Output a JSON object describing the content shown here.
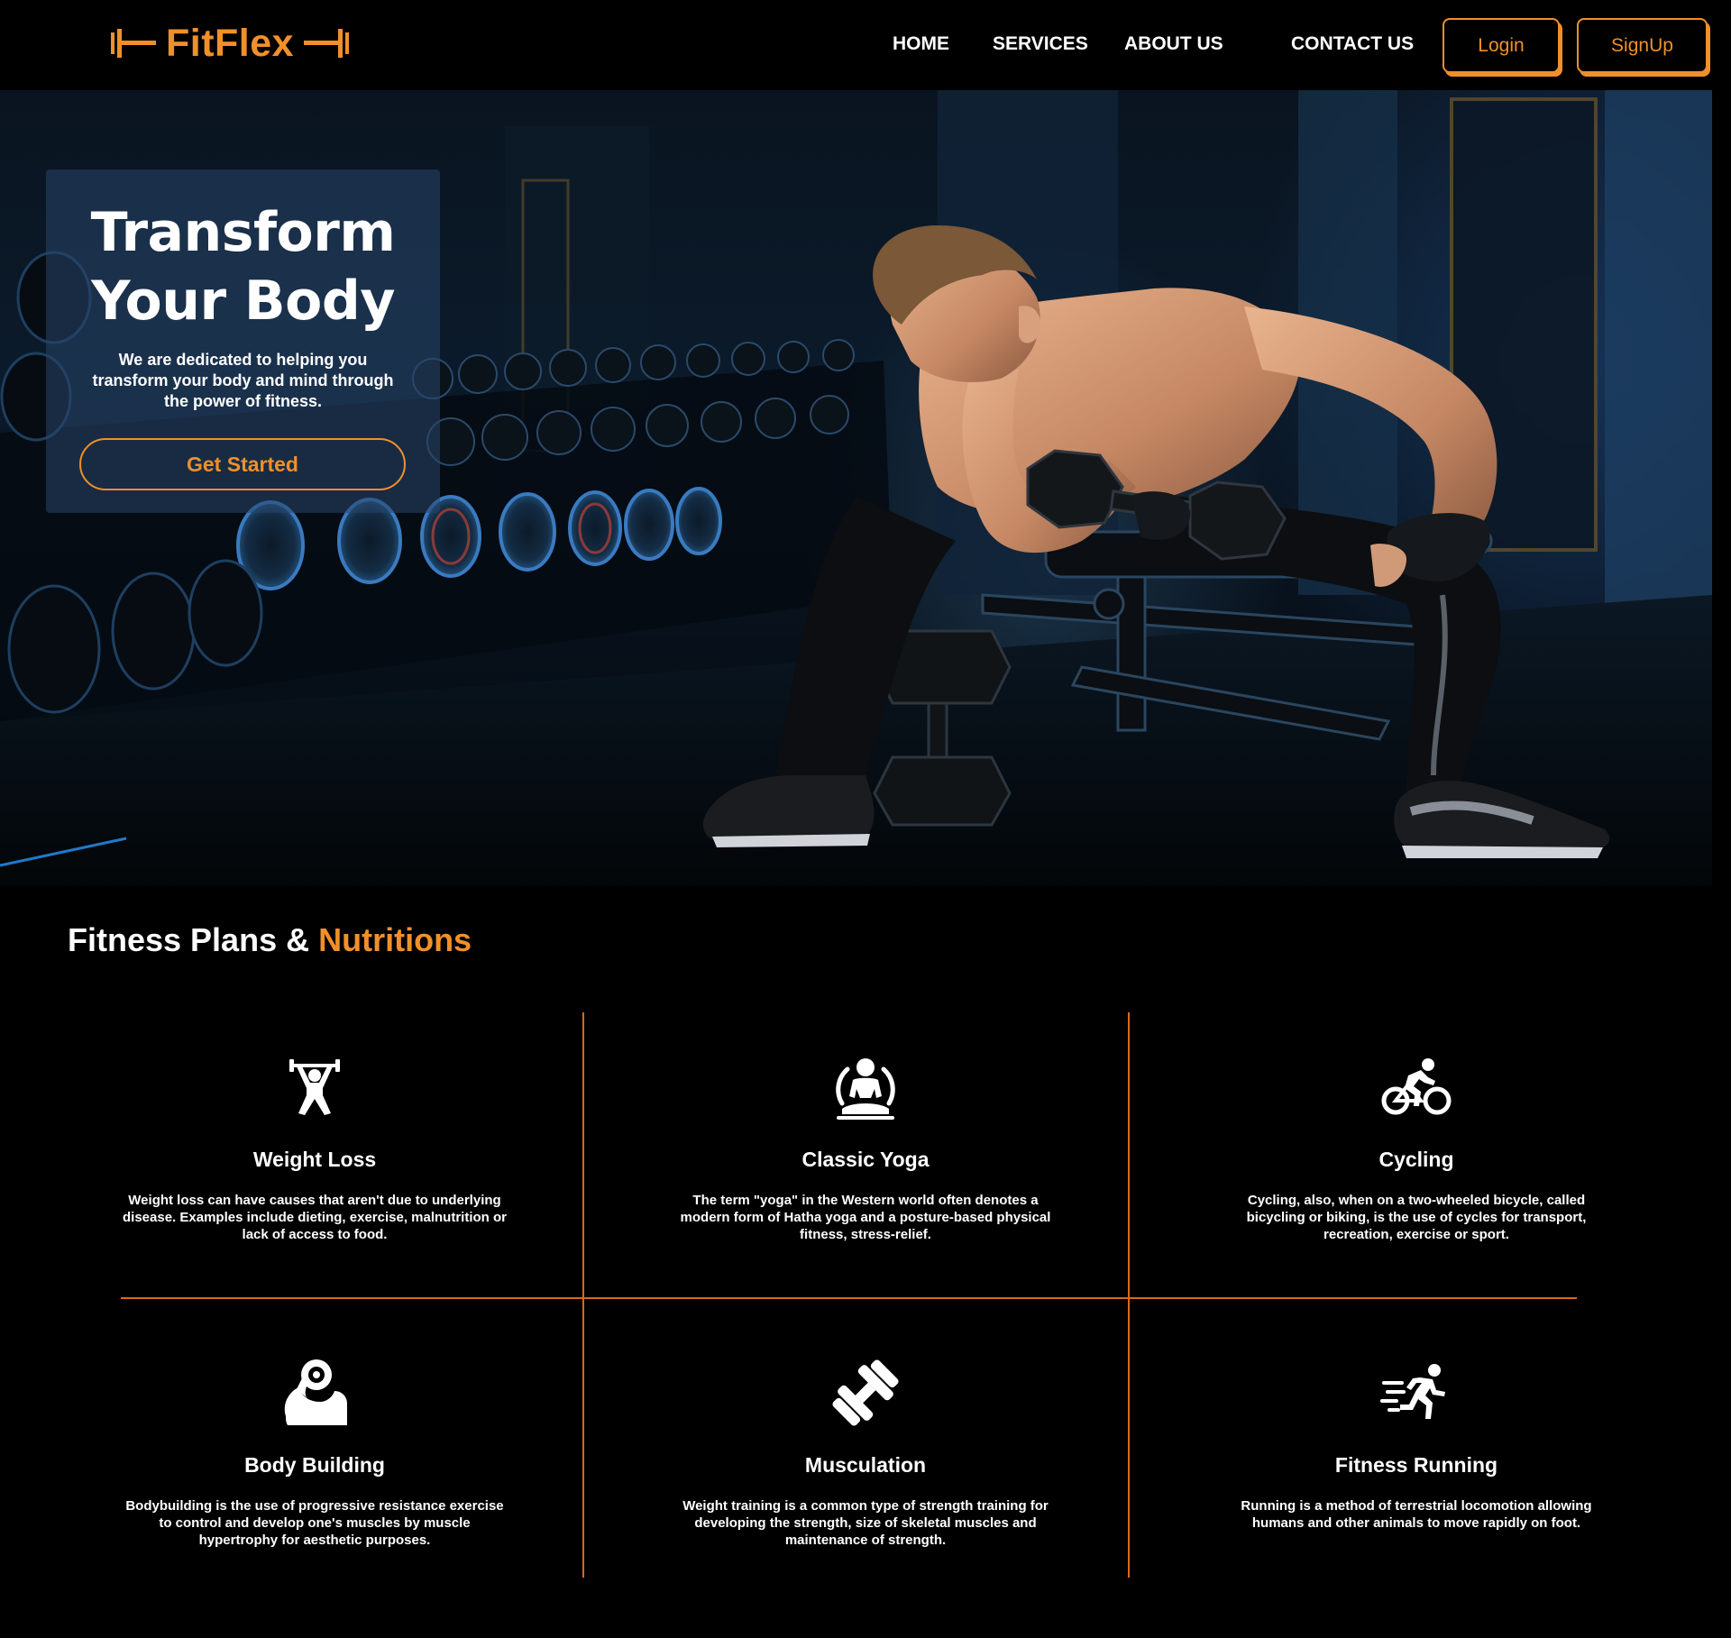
{
  "brand": {
    "name": "FitFlex",
    "accent_color": "#f0902a",
    "logo_icons": [
      "dumbbell-left-icon",
      "dumbbell-right-icon"
    ]
  },
  "nav": {
    "home": "HOME",
    "services": "SERVICES",
    "about": "ABOUT US",
    "contact": "CONTACT US"
  },
  "auth": {
    "login": "Login",
    "signup": "SignUp"
  },
  "hero": {
    "title_line1": "Transform",
    "title_line2": "Your Body",
    "text": "We are dedicated to helping you transform your body and mind through the power of fitness.",
    "cta": "Get Started"
  },
  "plans_section": {
    "title_main": "Fitness Plans & ",
    "title_accent": "Nutritions",
    "divider_color": "#d9691b",
    "items": [
      {
        "icon": "weightlifter-icon",
        "title": "Weight Loss",
        "desc": "Weight loss can have causes that aren't due to underlying disease. Examples include dieting, exercise, malnutrition or lack of access to food."
      },
      {
        "icon": "yoga-icon",
        "title": "Classic Yoga",
        "desc": "The term \"yoga\" in the Western world often denotes a modern form of Hatha yoga and a posture-based physical fitness, stress-relief."
      },
      {
        "icon": "cyclist-icon",
        "title": "Cycling",
        "desc": "Cycling, also, when on a two-wheeled bicycle, called bicycling or biking, is the use of cycles for transport, recreation, exercise or sport."
      },
      {
        "icon": "flexed-bicep-icon",
        "title": "Body Building",
        "desc": "Bodybuilding is the use of progressive resistance exercise to control and develop one's muscles by muscle hypertrophy for aesthetic purposes."
      },
      {
        "icon": "dumbbell-icon",
        "title": "Musculation",
        "desc": "Weight training is a common type of strength training for developing the strength, size of skeletal muscles and maintenance of strength."
      },
      {
        "icon": "runner-icon",
        "title": "Fitness Running",
        "desc": "Running is a method of terrestrial locomotion allowing humans and other animals to move rapidly on foot."
      }
    ]
  }
}
